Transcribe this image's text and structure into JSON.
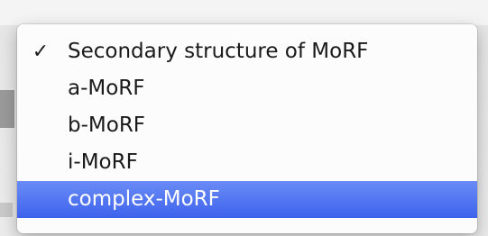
{
  "menu": {
    "items": [
      {
        "label": "Secondary structure of MoRF",
        "checked": true
      },
      {
        "label": "a-MoRF",
        "checked": false
      },
      {
        "label": "b-MoRF",
        "checked": false
      },
      {
        "label": "i-MoRF",
        "checked": false
      },
      {
        "label": "complex-MoRF",
        "checked": false,
        "highlighted": true
      }
    ],
    "check_glyph": "✓",
    "highlight_color": "#3d62ec"
  }
}
